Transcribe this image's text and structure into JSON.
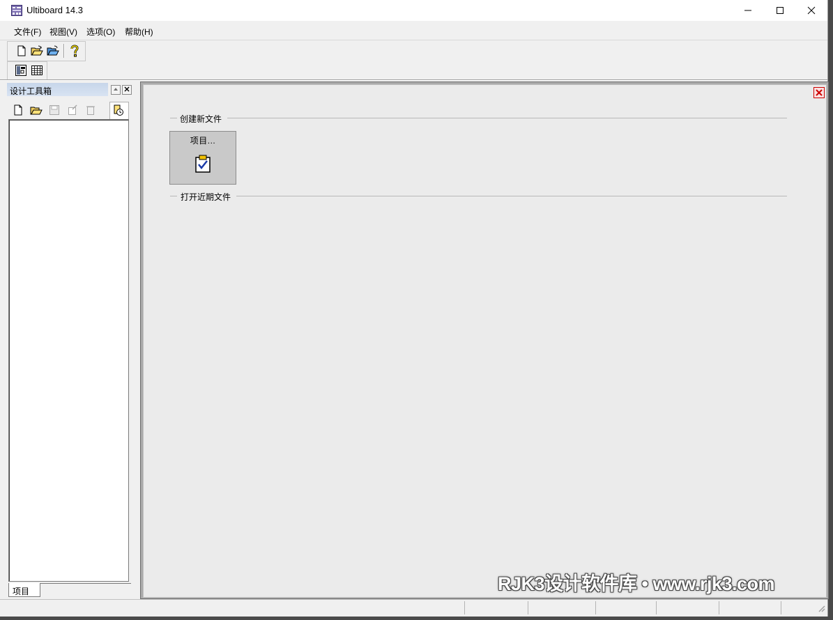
{
  "window": {
    "title": "Ultiboard 14.3",
    "icon": "ultiboard-app-icon",
    "controls": [
      "minimize-icon",
      "maximize-icon",
      "close-icon"
    ]
  },
  "menu": {
    "file": "文件(F)",
    "view": "视图(V)",
    "options": "选项(O)",
    "help": "帮助(H)"
  },
  "toolbar": {
    "main": [
      "new-file-icon",
      "open-file-icon",
      "open-project-icon",
      "help-icon"
    ],
    "secondary": [
      "design-toolbox-icon",
      "spreadsheet-icon"
    ]
  },
  "toolbox": {
    "title": "设计工具箱",
    "buttons": [
      "restore-icon",
      "close-icon"
    ],
    "tools": [
      "new-file-icon",
      "open-file-icon",
      "save-icon",
      "rename-icon",
      "delete-icon",
      "recent-files-icon"
    ],
    "tab_label": "项目"
  },
  "start_page": {
    "create_section": "创建新文件",
    "project_button": "项目...",
    "recent_section": "打开近期文件"
  },
  "watermark": "RJK3设计软件库 • www.rjk3.com",
  "colors": {
    "toolbox_header": "#c7d6ea",
    "start_page_bg": "#ebebeb",
    "project_tile": "#c9c9c9",
    "close_red": "#cc0000"
  }
}
